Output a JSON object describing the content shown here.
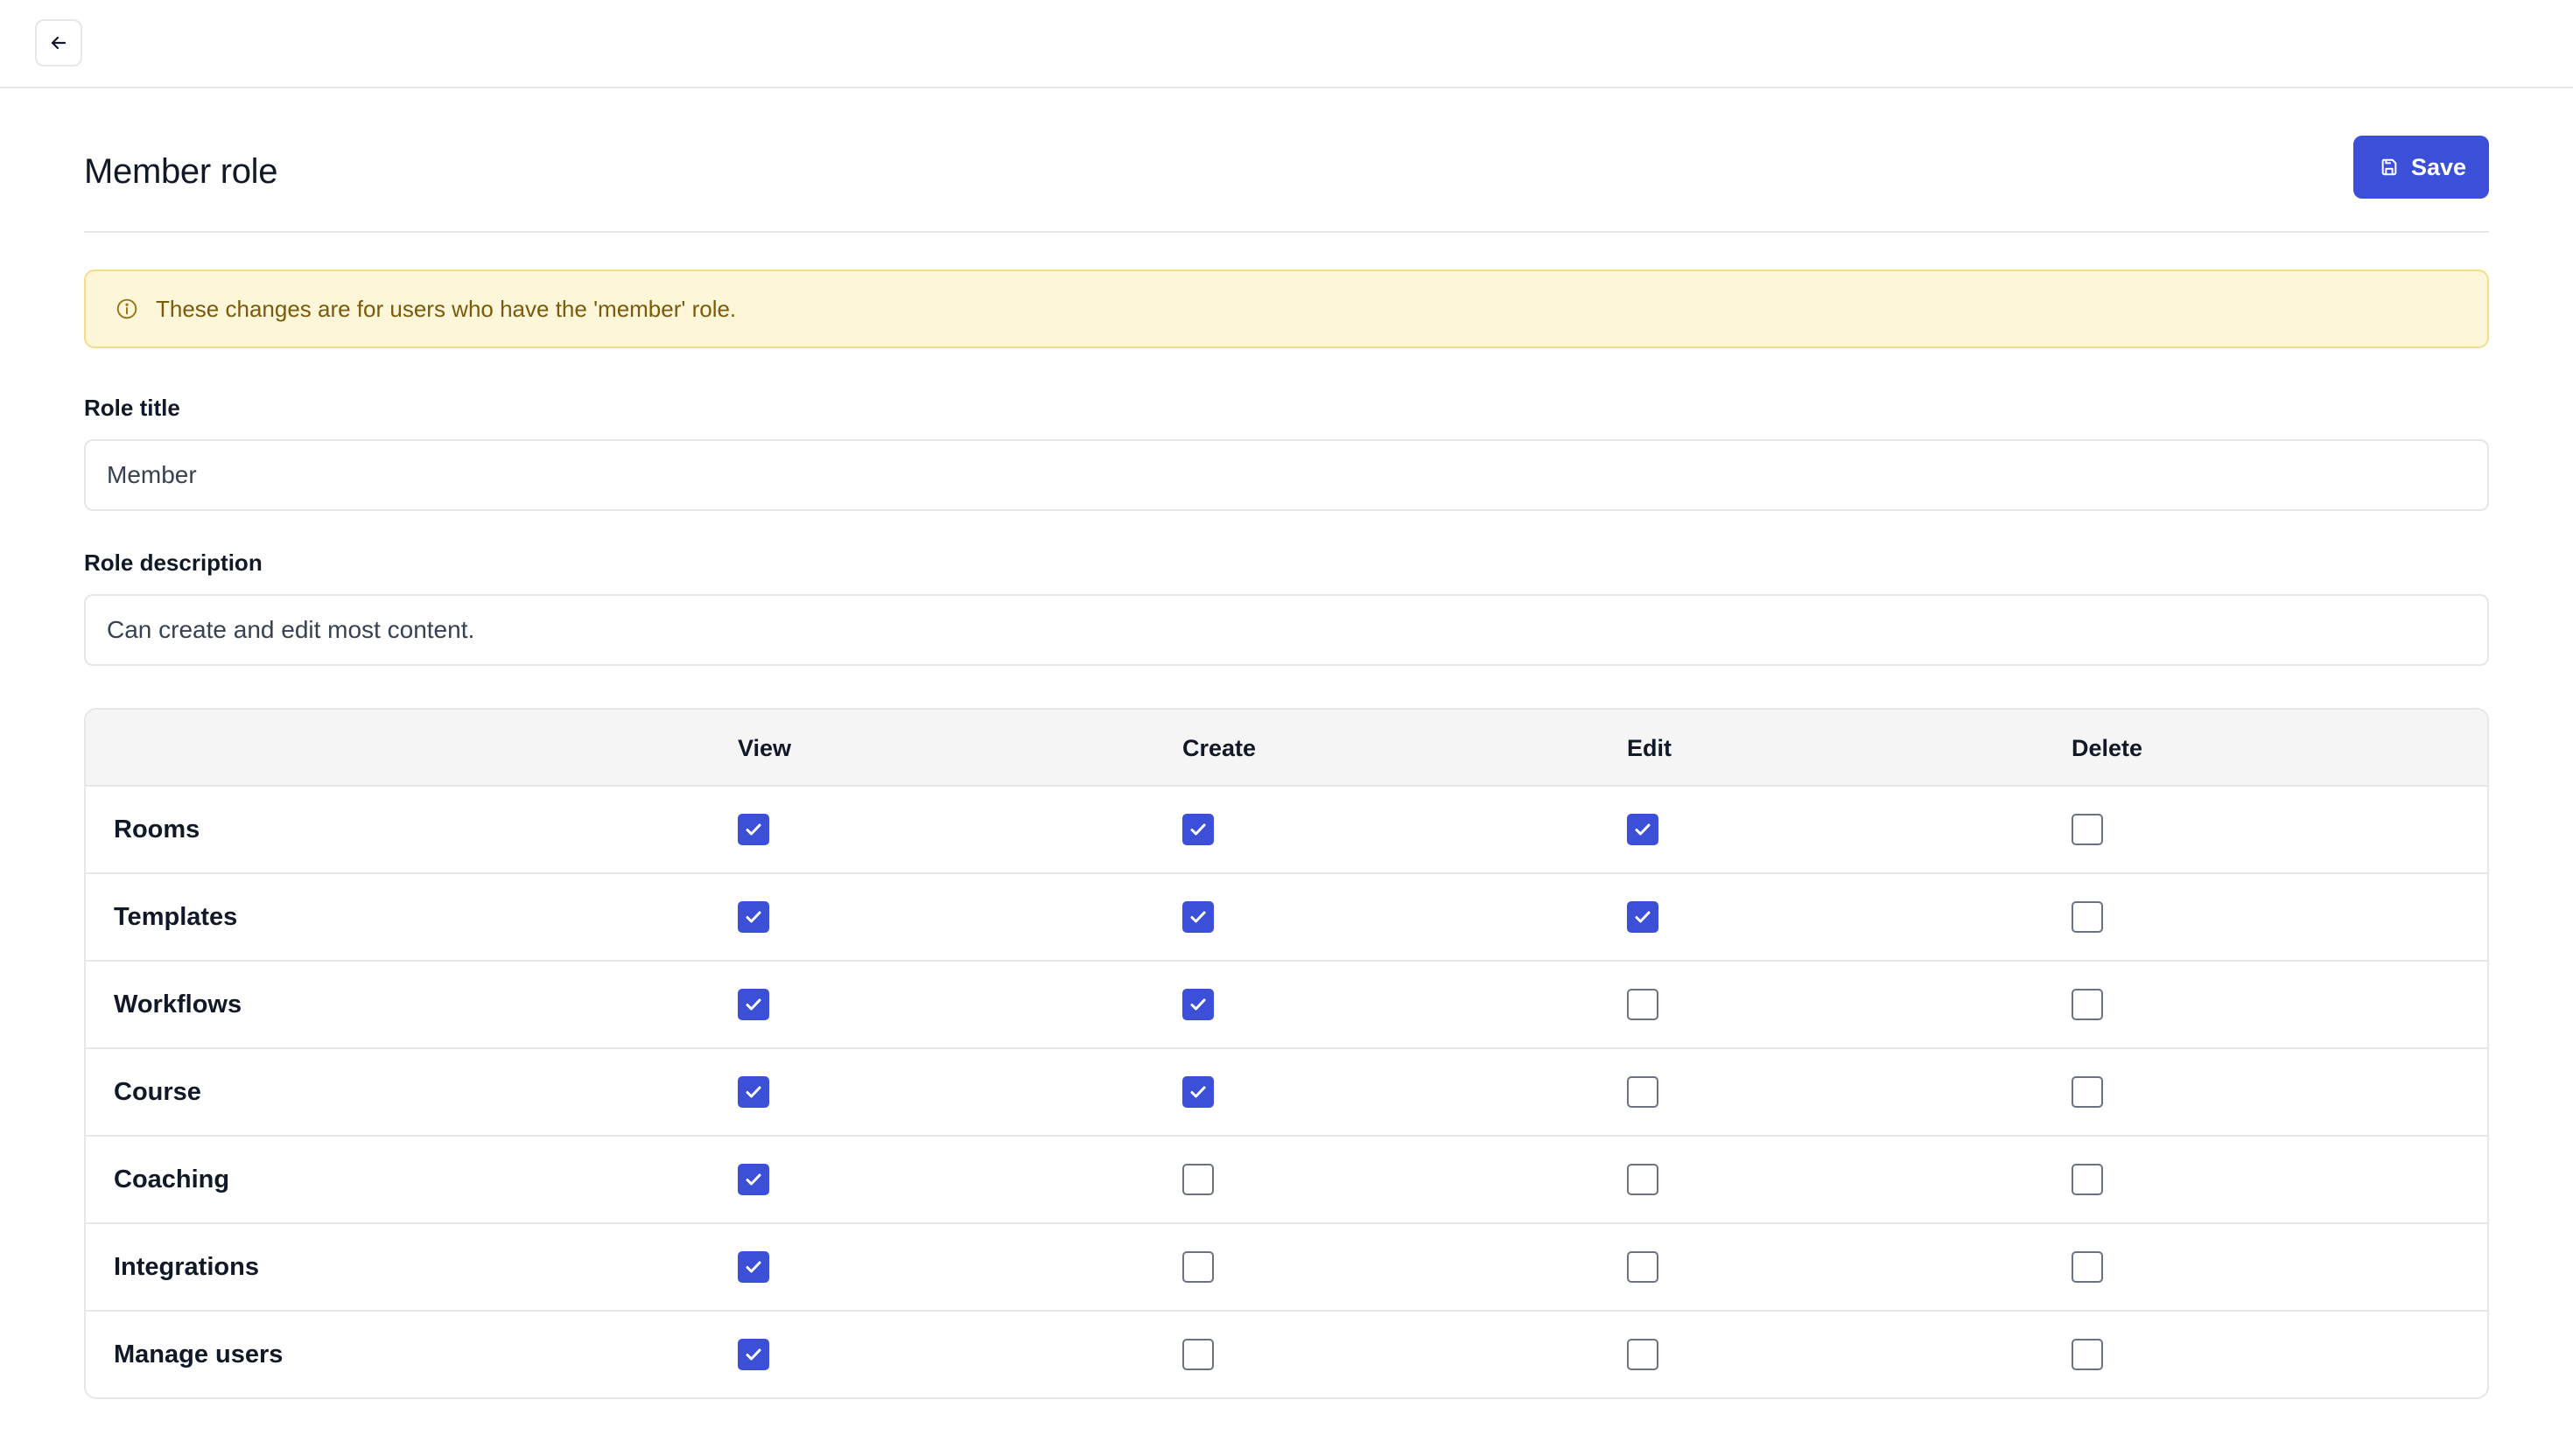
{
  "page": {
    "title": "Member role",
    "save_label": "Save",
    "back_icon": "arrow-left-icon"
  },
  "alert": {
    "icon": "info-icon",
    "text": "These changes are for users who have the 'member' role."
  },
  "form": {
    "role_title_label": "Role title",
    "role_title_value": "Member",
    "role_description_label": "Role description",
    "role_description_value": "Can create and edit most content."
  },
  "permissions": {
    "columns": [
      "View",
      "Create",
      "Edit",
      "Delete"
    ],
    "rows": [
      {
        "label": "Rooms",
        "view": true,
        "create": true,
        "edit": true,
        "delete": false
      },
      {
        "label": "Templates",
        "view": true,
        "create": true,
        "edit": true,
        "delete": false
      },
      {
        "label": "Workflows",
        "view": true,
        "create": true,
        "edit": false,
        "delete": false
      },
      {
        "label": "Course",
        "view": true,
        "create": true,
        "edit": false,
        "delete": false
      },
      {
        "label": "Coaching",
        "view": true,
        "create": false,
        "edit": false,
        "delete": false
      },
      {
        "label": "Integrations",
        "view": true,
        "create": false,
        "edit": false,
        "delete": false
      },
      {
        "label": "Manage users",
        "view": true,
        "create": false,
        "edit": false,
        "delete": false
      }
    ]
  },
  "colors": {
    "accent": "#3b4fd8",
    "alert_bg": "#fdf6d8",
    "alert_text": "#7a5a0c"
  }
}
